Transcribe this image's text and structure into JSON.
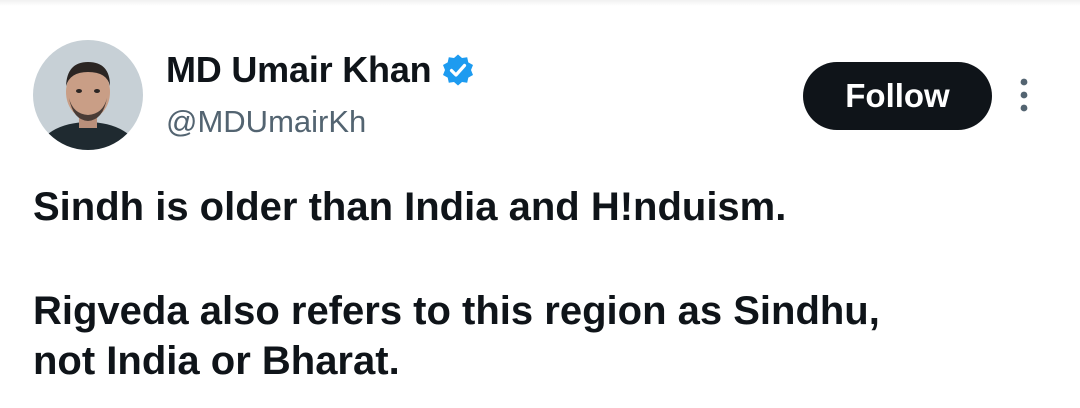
{
  "author": {
    "display_name": "MD Umair Khan",
    "handle": "@MDUmairKh",
    "verified_icon": "verified-badge-icon",
    "avatar": "profile-photo"
  },
  "actions": {
    "follow_label": "Follow",
    "more_icon": "more-vertical-icon"
  },
  "tweet": {
    "paragraphs": [
      "Sindh is older than India and H!nduism.",
      "Rigveda also refers to this region as Sindhu,\nnot India or Bharat."
    ]
  },
  "colors": {
    "text": "#0f1419",
    "secondary": "#536471",
    "button_bg": "#0f1419",
    "button_text": "#ffffff",
    "verified": "#1d9bf0"
  }
}
